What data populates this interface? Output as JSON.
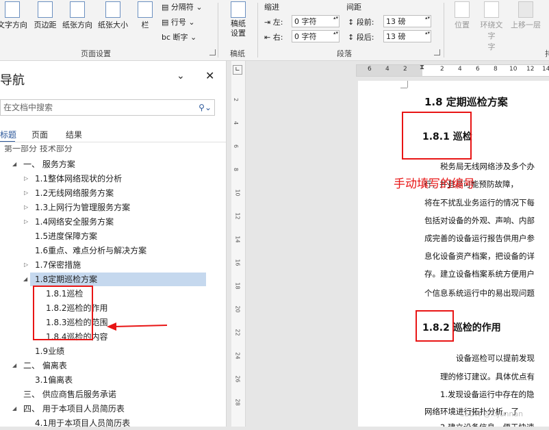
{
  "ribbon": {
    "buttons": [
      {
        "label": "文字方向",
        "icon": "text-direction-icon"
      },
      {
        "label": "页边距",
        "icon": "margins-icon"
      },
      {
        "label": "纸张方向",
        "icon": "orientation-icon"
      },
      {
        "label": "纸张大小",
        "icon": "paper-size-icon"
      },
      {
        "label": "栏",
        "icon": "columns-icon"
      }
    ],
    "small_buttons": [
      "分隔符",
      "行号",
      "断字"
    ],
    "page_setup_label": "页面设置",
    "manuscript_button": "稿纸设置",
    "manuscript_group_label": "稿纸",
    "indent_label": "缩进",
    "spacing_label": "间距",
    "indent_left_label": "左:",
    "indent_left_value": "0 字符",
    "indent_right_label": "右:",
    "indent_right_value": "0 字符",
    "space_before_label": "段前:",
    "space_before_value": "13 磅",
    "space_after_label": "段后:",
    "space_after_value": "13 磅",
    "paragraph_label": "段落",
    "arrange_buttons": [
      "位置",
      "环绕文字",
      "上移一层"
    ],
    "arrange_button_dropdown_suffix": "字",
    "arrange_truncated_label": "排"
  },
  "nav": {
    "title": "导航",
    "search_placeholder": "在文档中搜索",
    "tabs": [
      "标题",
      "页面",
      "结果"
    ],
    "items": [
      {
        "label": "第一部分 技术部分",
        "level": 0
      },
      {
        "label": "一、 服务方案",
        "level": 1,
        "expanded": true
      },
      {
        "label": "1.1整体网络现状的分析",
        "level": 2
      },
      {
        "label": "1.2无线网络服务方案",
        "level": 2
      },
      {
        "label": "1.3上网行为管理服务方案",
        "level": 2
      },
      {
        "label": "1.4网络安全服务方案",
        "level": 2
      },
      {
        "label": "1.5进度保障方案",
        "level": 2
      },
      {
        "label": "1.6重点、难点分析与解决方案",
        "level": 2
      },
      {
        "label": "1.7保密措施",
        "level": 2
      },
      {
        "label": "1.8定期巡检方案",
        "level": 2,
        "selected": true,
        "expanded": true
      },
      {
        "label": "1.8.1巡检",
        "level": 3
      },
      {
        "label": "1.8.2巡检的作用",
        "level": 3
      },
      {
        "label": "1.8.3巡检的范围",
        "level": 3
      },
      {
        "label": "1.8.4巡检的内容",
        "level": 3
      },
      {
        "label": "1.9业绩",
        "level": 2
      },
      {
        "label": "二、 偏离表",
        "level": 1,
        "expanded": true
      },
      {
        "label": "3.1偏离表",
        "level": 2
      },
      {
        "label": "三、 供应商售后服务承诺",
        "level": 1
      },
      {
        "label": "四、 用于本项目人员简历表",
        "level": 1,
        "expanded": true
      },
      {
        "label": "4.1用于本项目人员简历表",
        "level": 2
      }
    ]
  },
  "ruler": {
    "h_numbers": [
      "6",
      "4",
      "2",
      "2",
      "4",
      "6",
      "8",
      "10",
      "12",
      "14",
      "16"
    ],
    "v_numbers": [
      "2",
      "4",
      "6",
      "8",
      "10",
      "12",
      "14",
      "16",
      "18",
      "20",
      "22",
      "24",
      "26",
      "28"
    ]
  },
  "doc": {
    "heading1": "1.8 定期巡检方案",
    "heading2a": "1.8.1 巡检",
    "para1": [
      "税务局无线网络涉及多个办",
      "行，并且尽可能预防故障，",
      "将在不扰乱业务运行的情况下每",
      "包括对设备的外观、声响、内部",
      "成完善的设备运行报告供用户参",
      "息化设备资产档案，把设备的详",
      "存。建立设备档案系统方便用户",
      "个信息系统运行中的易出现问题"
    ],
    "heading2b": "1.8.2 巡检的作用",
    "para2": [
      "设备巡检可以提前发现",
      "理的修订建议。具体优点有",
      "1.发现设备运行中存在的隐",
      "网络环境进行拓扑分析，了",
      "2.建立设备信息，便于快速"
    ]
  },
  "annotation": {
    "text": "手动填写的编号",
    "color": "#e81414"
  },
  "watermark": "CSDN @xijunnan"
}
